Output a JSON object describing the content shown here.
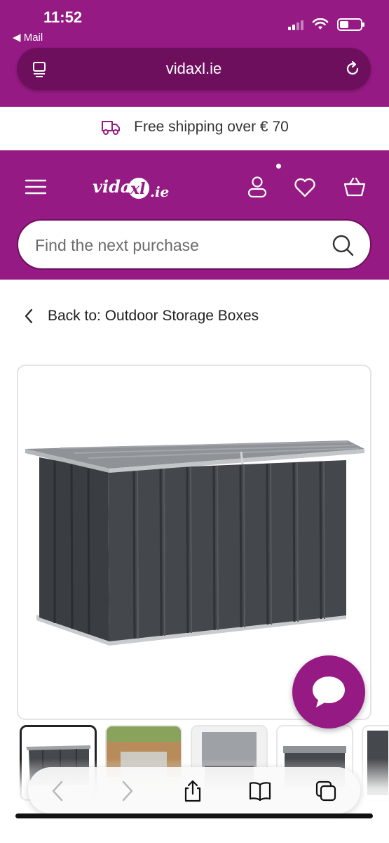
{
  "status_bar": {
    "time": "11:52",
    "back_app": "◀ Mail"
  },
  "browser": {
    "url": "vidaxl.ie",
    "reader_icon": "reader-icon",
    "reload_icon": "reload-icon"
  },
  "banner": {
    "icon": "delivery-truck-icon",
    "text": "Free shipping over € 70"
  },
  "header": {
    "logo_text": "vidaxl.ie",
    "brand_color": "#951A84",
    "dark_brand_color": "#6E0F5E",
    "icons": [
      "menu-icon",
      "user-icon",
      "heart-icon",
      "basket-icon"
    ]
  },
  "search": {
    "placeholder": "Find the next purchase"
  },
  "breadcrumb": {
    "back_label": "Back to: Outdoor Storage Boxes"
  },
  "product": {
    "image_alt": "Anthracite metal garden storage box",
    "thumbnails": [
      "storage box front",
      "storage box on patio",
      "storage box open",
      "storage box side",
      "storage box detail"
    ]
  },
  "chat": {
    "icon": "chat-bubble-icon"
  },
  "safari_toolbar": {
    "buttons": [
      "back-arrow-icon",
      "forward-arrow-icon",
      "share-icon",
      "bookmarks-icon",
      "tabs-icon"
    ]
  }
}
